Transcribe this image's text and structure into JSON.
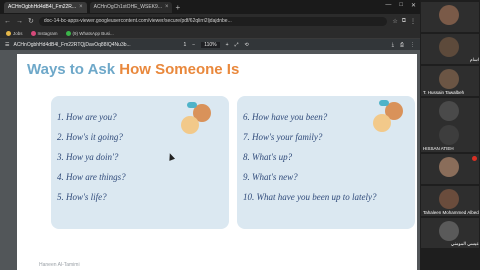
{
  "browser": {
    "tabs": [
      {
        "label": "ACHnOgbhHd4dB4l_Fm22R...",
        "active": true
      },
      {
        "label": "ACHnOgCh1xtOHE_WSEK9...",
        "active": false
      }
    ],
    "url": "doc-14-bc-apps-viewer.googleusercontent.com/viewer/secure/pdf/62qlirri2ljdajdnbe...",
    "bookmarks": [
      "Jobs",
      "Instagram",
      "(9) WhatsApp Busi..."
    ],
    "pdf": {
      "title": "ACHnOgbhHd4dB4l_Fm22RTQjDavOq88IQ4Nu3b...",
      "page": "1",
      "zoom": "110%"
    }
  },
  "slide": {
    "heading_part1": "Ways to Ask",
    "heading_part2": "How Someone Is",
    "left_questions": [
      "1. How are you?",
      "2. How's it going?",
      "3. How ya doin'?",
      "4. How are things?",
      "5. How's life?"
    ],
    "right_questions": [
      "6. How have you been?",
      "7. How's your family?",
      "8. What's up?",
      "9. What's new?",
      "10. What have you been up to lately?"
    ],
    "footer": "Haneen Al-Tamimi"
  },
  "participants": [
    {
      "name": "",
      "color": "#7a5a48"
    },
    {
      "name": "اسام",
      "color": "#5d4a3b"
    },
    {
      "name": "T. Hussain Tawalbeh",
      "color": "#6b5544"
    },
    {
      "name": "",
      "color": "#4a4a4a"
    },
    {
      "name": "HISSAN ATIEH",
      "color": "#3d3d3d"
    },
    {
      "name": "",
      "color": "#8a6d5a"
    },
    {
      "name": "Tahaleen Mohammed Albedaiwi",
      "color": "#6a4c3c"
    },
    {
      "name": "عيسي المومني",
      "color": "#5a5a5a"
    }
  ],
  "colors": {
    "heading_blue": "#6ea8c9",
    "heading_orange": "#e9883c",
    "card_bg": "#dbe8f1",
    "question_text": "#2f4a7a"
  }
}
